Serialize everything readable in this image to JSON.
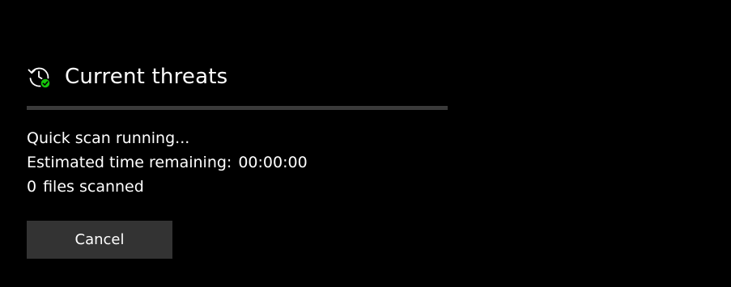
{
  "top_clipped_text": "",
  "section": {
    "icon": "history-check-icon",
    "title": "Current threats"
  },
  "scan": {
    "progress_fraction": 0.0,
    "status": "Quick scan running...",
    "time_label": "Estimated time remaining:",
    "time_value": "00:00:00",
    "files_count": "0",
    "files_label": "files scanned"
  },
  "actions": {
    "cancel_label": "Cancel"
  },
  "colors": {
    "background": "#000000",
    "text": "#ffffff",
    "accent_check": "#16c60c",
    "button_bg": "#333333",
    "progress_track": "#3a3a3a"
  }
}
